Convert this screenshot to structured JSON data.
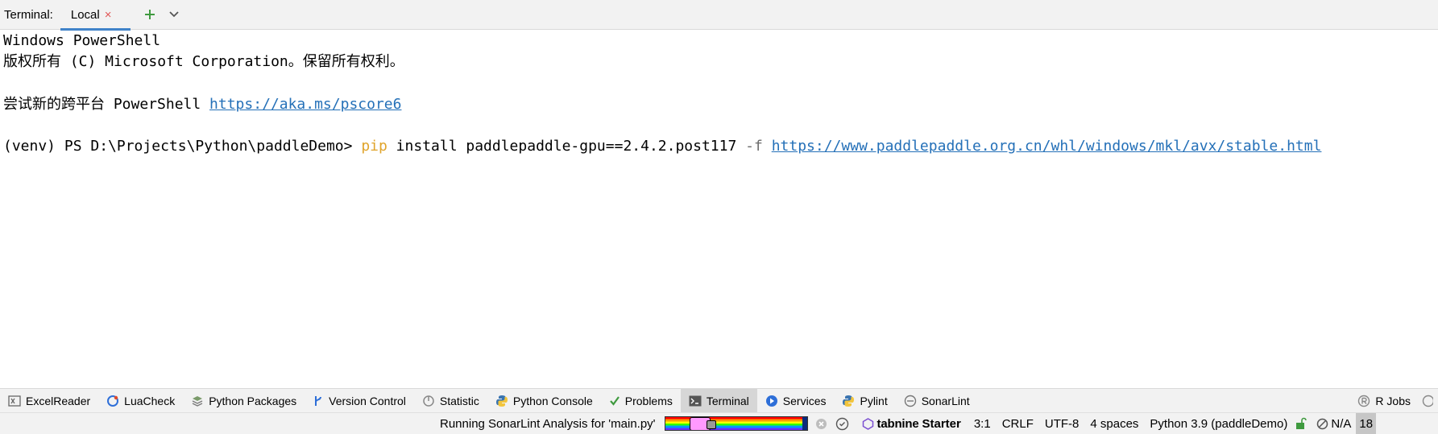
{
  "header": {
    "title": "Terminal:",
    "tab_label": "Local",
    "tab_close": "×"
  },
  "terminal": {
    "lines": {
      "l1": "Windows PowerShell",
      "l2": "版权所有 (C) Microsoft Corporation。保留所有权利。",
      "l3_text": "尝试新的跨平台 PowerShell ",
      "l3_link": "https://aka.ms/pscore6",
      "prompt": "(venv) PS D:\\Projects\\Python\\paddleDemo> ",
      "cmd_pip": "pip",
      "cmd_rest": " install paddlepaddle-gpu==2.4.2.post117 ",
      "cmd_flag": "-f",
      "cmd_link": "https://www.paddlepaddle.org.cn/whl/windows/mkl/avx/stable.html"
    }
  },
  "tool_windows": {
    "excel_reader": "ExcelReader",
    "luacheck": "LuaCheck",
    "python_packages": "Python Packages",
    "version_control": "Version Control",
    "statistic": "Statistic",
    "python_console": "Python Console",
    "problems": "Problems",
    "terminal": "Terminal",
    "services": "Services",
    "pylint": "Pylint",
    "sonarlint": "SonarLint",
    "r_jobs": "R Jobs"
  },
  "status": {
    "task": "Running SonarLint Analysis for 'main.py'",
    "progress": 0.97,
    "tabnine_brand": "tabnine",
    "tabnine_plan": "Starter",
    "position": "3:1",
    "line_sep": "CRLF",
    "encoding": "UTF-8",
    "indent": "4 spaces",
    "interpreter": "Python 3.9 (paddleDemo)",
    "na": "N/A",
    "counter": "18"
  },
  "colors": {
    "link": "#2470b8",
    "pip": "#e0a42b",
    "accent": "#4083c9",
    "tab_close": "#e05555"
  }
}
